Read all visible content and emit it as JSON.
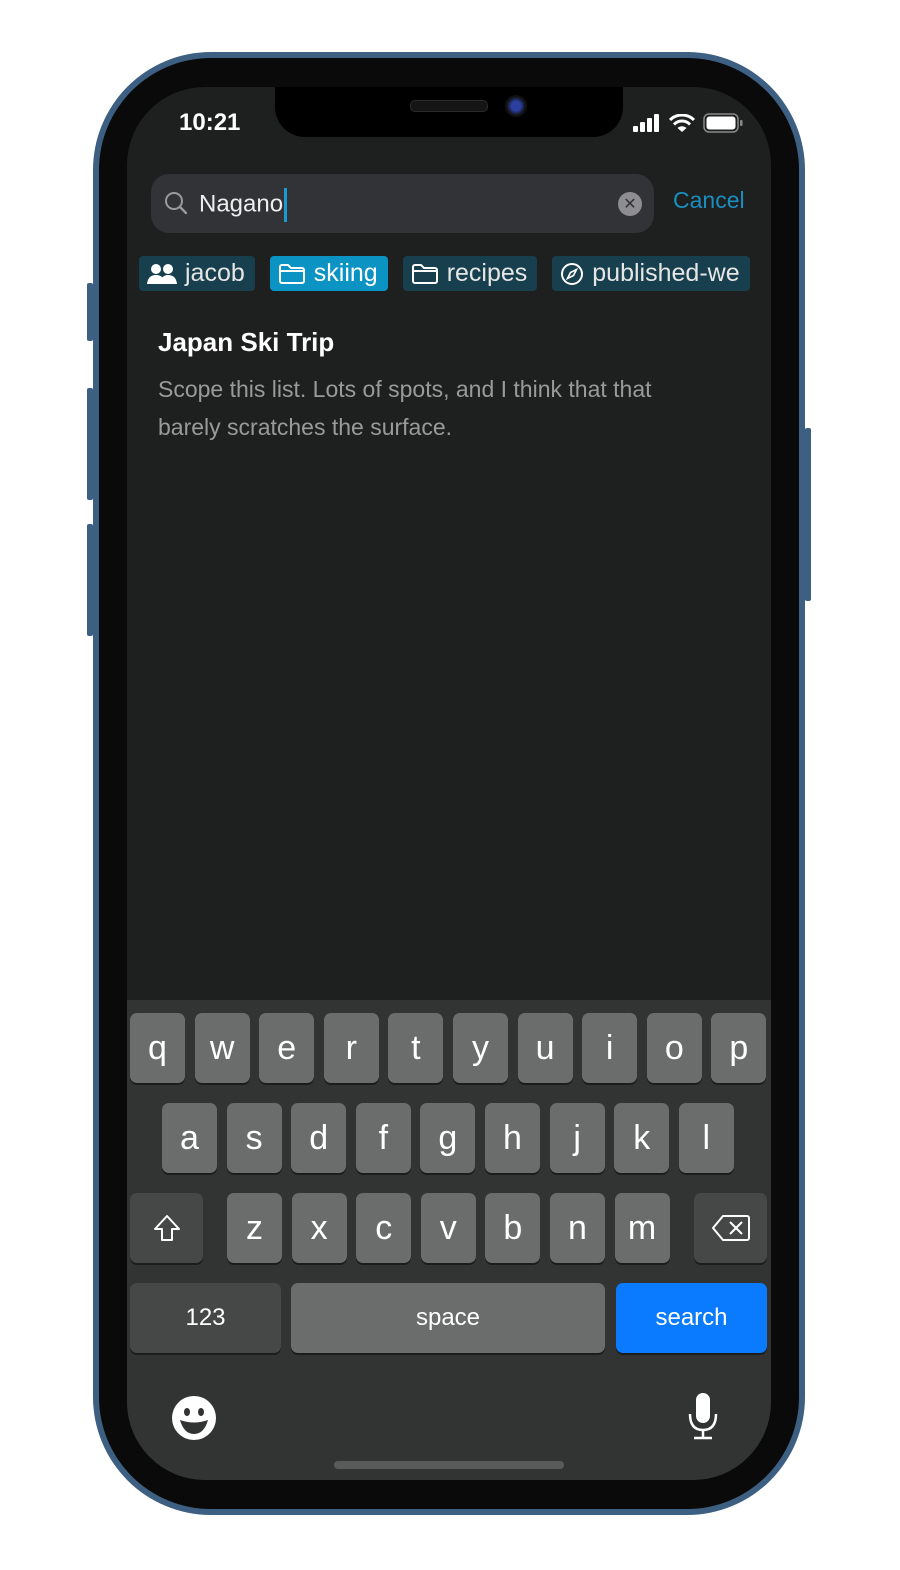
{
  "status_bar": {
    "time": "10:21",
    "icons": [
      "cellular-signal-icon",
      "wifi-icon",
      "battery-icon"
    ]
  },
  "search": {
    "value": "Nagano",
    "clear_icon": "clear-icon",
    "cancel_label": "Cancel"
  },
  "scopes": [
    {
      "label": "jacob",
      "icon": "people-icon",
      "active": false
    },
    {
      "label": "skiing",
      "icon": "folder-icon",
      "active": true
    },
    {
      "label": "recipes",
      "icon": "folder-icon",
      "active": false
    },
    {
      "label": "published-we",
      "icon": "compass-icon",
      "active": false
    }
  ],
  "results": [
    {
      "title": "Japan Ski Trip",
      "description": "Scope this list. Lots of spots, and I think that that barely scratches the surface."
    }
  ],
  "keyboard": {
    "row1": [
      "q",
      "w",
      "e",
      "r",
      "t",
      "y",
      "u",
      "i",
      "o",
      "p"
    ],
    "row2": [
      "a",
      "s",
      "d",
      "f",
      "g",
      "h",
      "j",
      "k",
      "l"
    ],
    "row3": [
      "z",
      "x",
      "c",
      "v",
      "b",
      "n",
      "m"
    ],
    "numbers_label": "123",
    "space_label": "space",
    "search_label": "search"
  },
  "colors": {
    "accent": "#1a8fbf",
    "active_chip": "#0b93c3",
    "chip": "#173f4d",
    "search_key": "#0a7aff"
  }
}
